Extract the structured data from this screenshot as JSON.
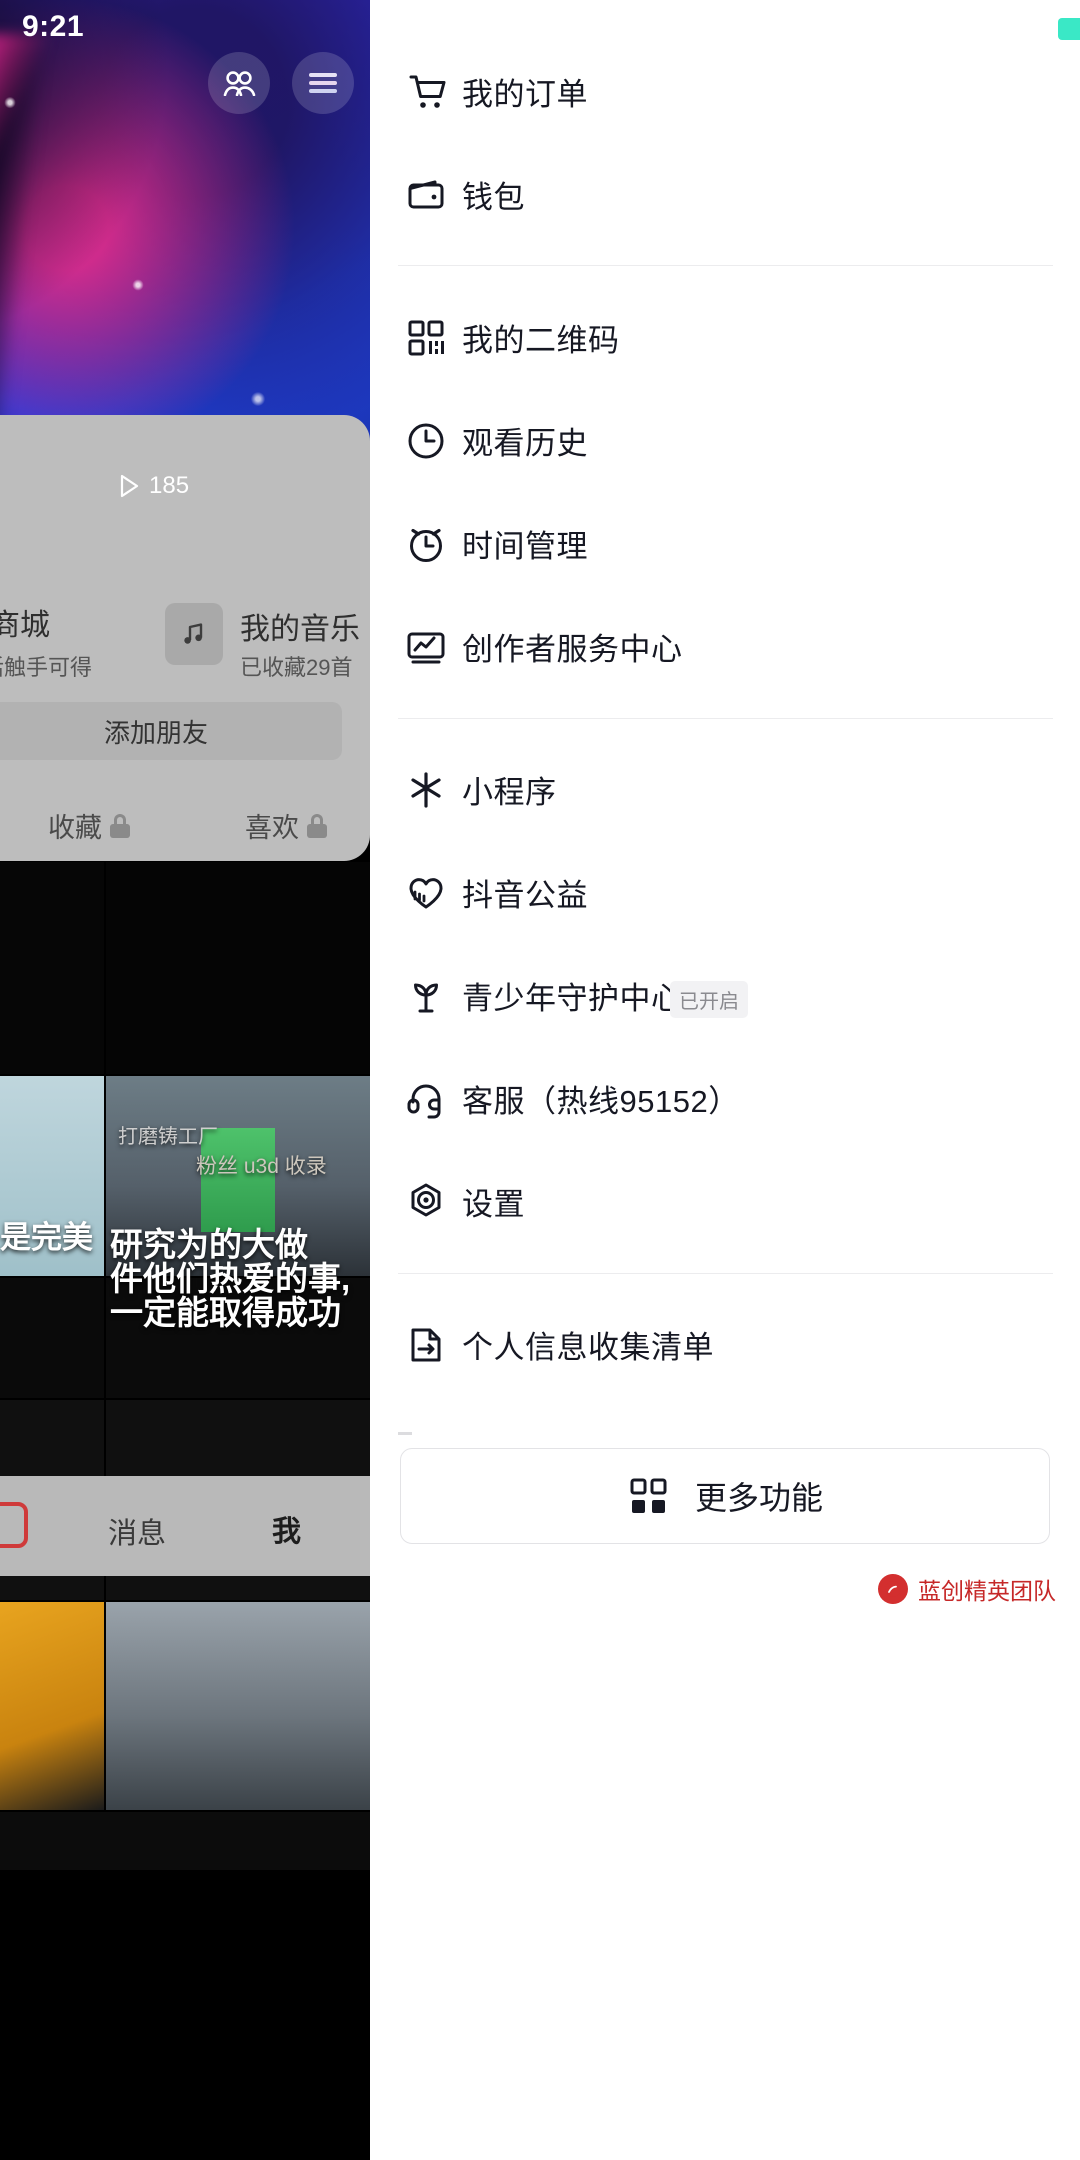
{
  "status_bar": {
    "time": "9:21"
  },
  "profile_behind": {
    "header_icons": [
      {
        "name": "friends-icon",
        "glyph": "friends"
      },
      {
        "name": "hamburger-menu-icon",
        "glyph": "menu"
      }
    ],
    "mall": {
      "title": "商城",
      "subtitle": "活触手可得"
    },
    "music": {
      "title": "我的音乐",
      "subtitle": "已收藏29首"
    },
    "add_friend_label": "添加朋友",
    "tabs": [
      {
        "label": "收藏",
        "locked": true
      },
      {
        "label": "喜欢",
        "locked": true
      }
    ],
    "play_count": "185",
    "video_texts": [
      "打磨铸工厂",
      "粉丝 u3d 收录",
      "是完美",
      "研究为的大做",
      "件他们热爱的事,",
      "一定能取得成功"
    ],
    "bottom_nav": [
      {
        "label": "消息",
        "active": false
      },
      {
        "label": "我",
        "active": true
      }
    ]
  },
  "drawer": {
    "groups": [
      {
        "items": [
          {
            "icon": "shopping-cart-icon",
            "label": "我的订单",
            "badge": ""
          },
          {
            "icon": "wallet-icon",
            "label": "钱包",
            "badge": ""
          }
        ]
      },
      {
        "items": [
          {
            "icon": "qr-code-icon",
            "label": "我的二维码",
            "badge": ""
          },
          {
            "icon": "clock-icon",
            "label": "观看历史",
            "badge": ""
          },
          {
            "icon": "alarm-clock-icon",
            "label": "时间管理",
            "badge": ""
          },
          {
            "icon": "creator-chart-icon",
            "label": "创作者服务中心",
            "badge": ""
          }
        ]
      },
      {
        "items": [
          {
            "icon": "mini-program-icon",
            "label": "小程序",
            "badge": ""
          },
          {
            "icon": "charity-heart-icon",
            "label": "抖音公益",
            "badge": ""
          },
          {
            "icon": "sprout-icon",
            "label": "青少年守护中心",
            "badge": "已开启"
          },
          {
            "icon": "headset-icon",
            "label": "客服（热线95152）",
            "badge": ""
          },
          {
            "icon": "settings-gear-icon",
            "label": "设置",
            "badge": ""
          }
        ]
      },
      {
        "items": [
          {
            "icon": "personal-info-icon",
            "label": "个人信息收集清单",
            "badge": ""
          }
        ]
      }
    ],
    "more_button": {
      "icon": "grid-apps-icon",
      "label": "更多功能"
    },
    "watermark": {
      "text": "蓝创精英团队"
    }
  }
}
